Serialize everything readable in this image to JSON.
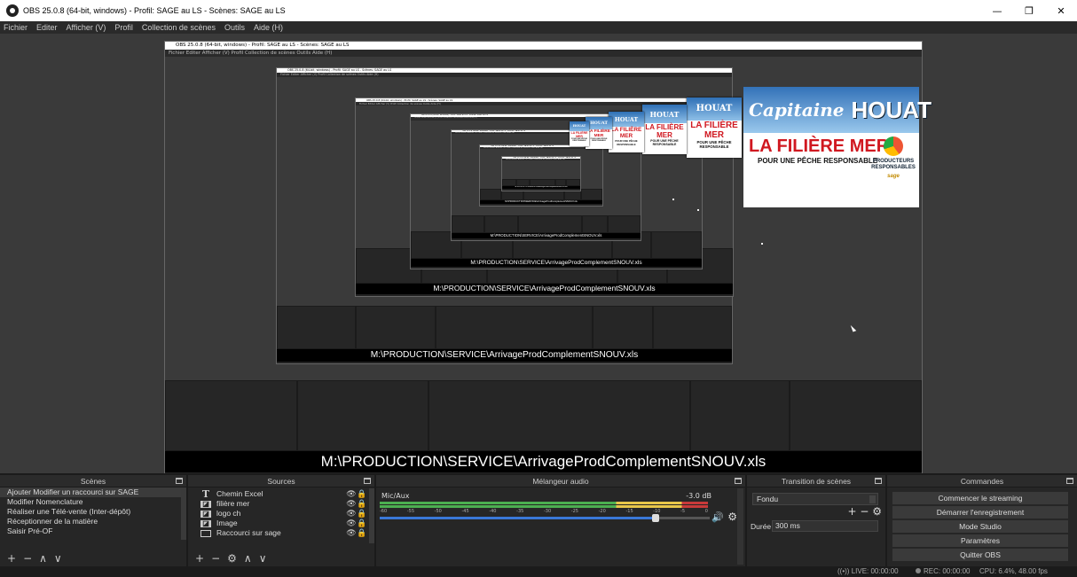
{
  "window": {
    "title": "OBS 25.0.8 (64-bit, windows) - Profil: SAGE au LS - Scènes: SAGE au LS",
    "minimize": "—",
    "maximize": "❐",
    "close": "✕"
  },
  "menu": [
    "Fichier",
    "Editer",
    "Afficher (V)",
    "Profil",
    "Collection de scènes",
    "Outils",
    "Aide (H)"
  ],
  "preview": {
    "nested_title": "OBS 25.0.8 (64-bit, windows) - Profil: SAGE au LS - Scènes: SAGE au LS",
    "nested_menu": "Fichier   Editer   Afficher (V)   Profil   Collection de scènes   Outils   Aide (H)",
    "file_path": "M:\\PRODUCTION\\SERVICE\\ArrivageProdComplementSNOUV.xls",
    "logo_brand_script": "Capitaine",
    "logo_brand_main": "HOUAT",
    "logo_filiere": "LA FILIÈRE MER",
    "logo_peche": "POUR UNE PÊCHE RESPONSABLE",
    "logo_producteurs": "PRODUCTEURS RESPONSABLES",
    "logo_sage": "sage"
  },
  "scenes": {
    "header": "Scènes",
    "items": [
      "Ajouter Modifier un raccourci sur SAGE",
      "Modifier Nomenclature",
      "Réaliser une Télé-vente (Inter-dépôt)",
      "Réceptionner de la matière",
      "Saisir Pré-OF"
    ],
    "selected_index": 0,
    "toolbar": {
      "add": "+",
      "remove": "−",
      "up": "∧",
      "down": "∨"
    }
  },
  "sources": {
    "header": "Sources",
    "items": [
      {
        "name": "Chemin Excel",
        "icon": "text-icon"
      },
      {
        "name": "filière mer",
        "icon": "image-icon"
      },
      {
        "name": "logo ch",
        "icon": "image-icon"
      },
      {
        "name": "Image",
        "icon": "image-icon"
      },
      {
        "name": "Raccourci sur sage",
        "icon": "display-capture-icon"
      }
    ],
    "toolbar": {
      "add": "+",
      "remove": "−",
      "settings": "⚙",
      "up": "∧",
      "down": "∨"
    }
  },
  "mixer": {
    "header": "Mélangeur audio",
    "track_name": "Mic/Aux",
    "level_db": "-3.0 dB",
    "tick_labels": [
      "-60",
      "-55",
      "-50",
      "-45",
      "-40",
      "-35",
      "-30",
      "-25",
      "-20",
      "-15",
      "-10",
      "-5",
      "0"
    ],
    "fader_fraction": 0.84
  },
  "transitions": {
    "header": "Transition de scènes",
    "selected": "Fondu",
    "duration_label": "Durée",
    "duration_value": "300 ms",
    "add": "+",
    "remove": "−"
  },
  "commands": {
    "header": "Commandes",
    "buttons": [
      "Commencer le streaming",
      "Démarrer l'enregistrement",
      "Mode Studio",
      "Paramètres",
      "Quitter OBS"
    ]
  },
  "status": {
    "live": "LIVE: 00:00:00",
    "rec": "REC: 00:00:00",
    "cpu": "CPU: 6.4%, 48.00 fps"
  },
  "colors": {
    "meter_green": "#4caf50",
    "meter_yellow": "#e8c64a",
    "meter_red": "#c83a3a",
    "fader_blue": "#3a78d8",
    "logo_red": "#d01820"
  }
}
